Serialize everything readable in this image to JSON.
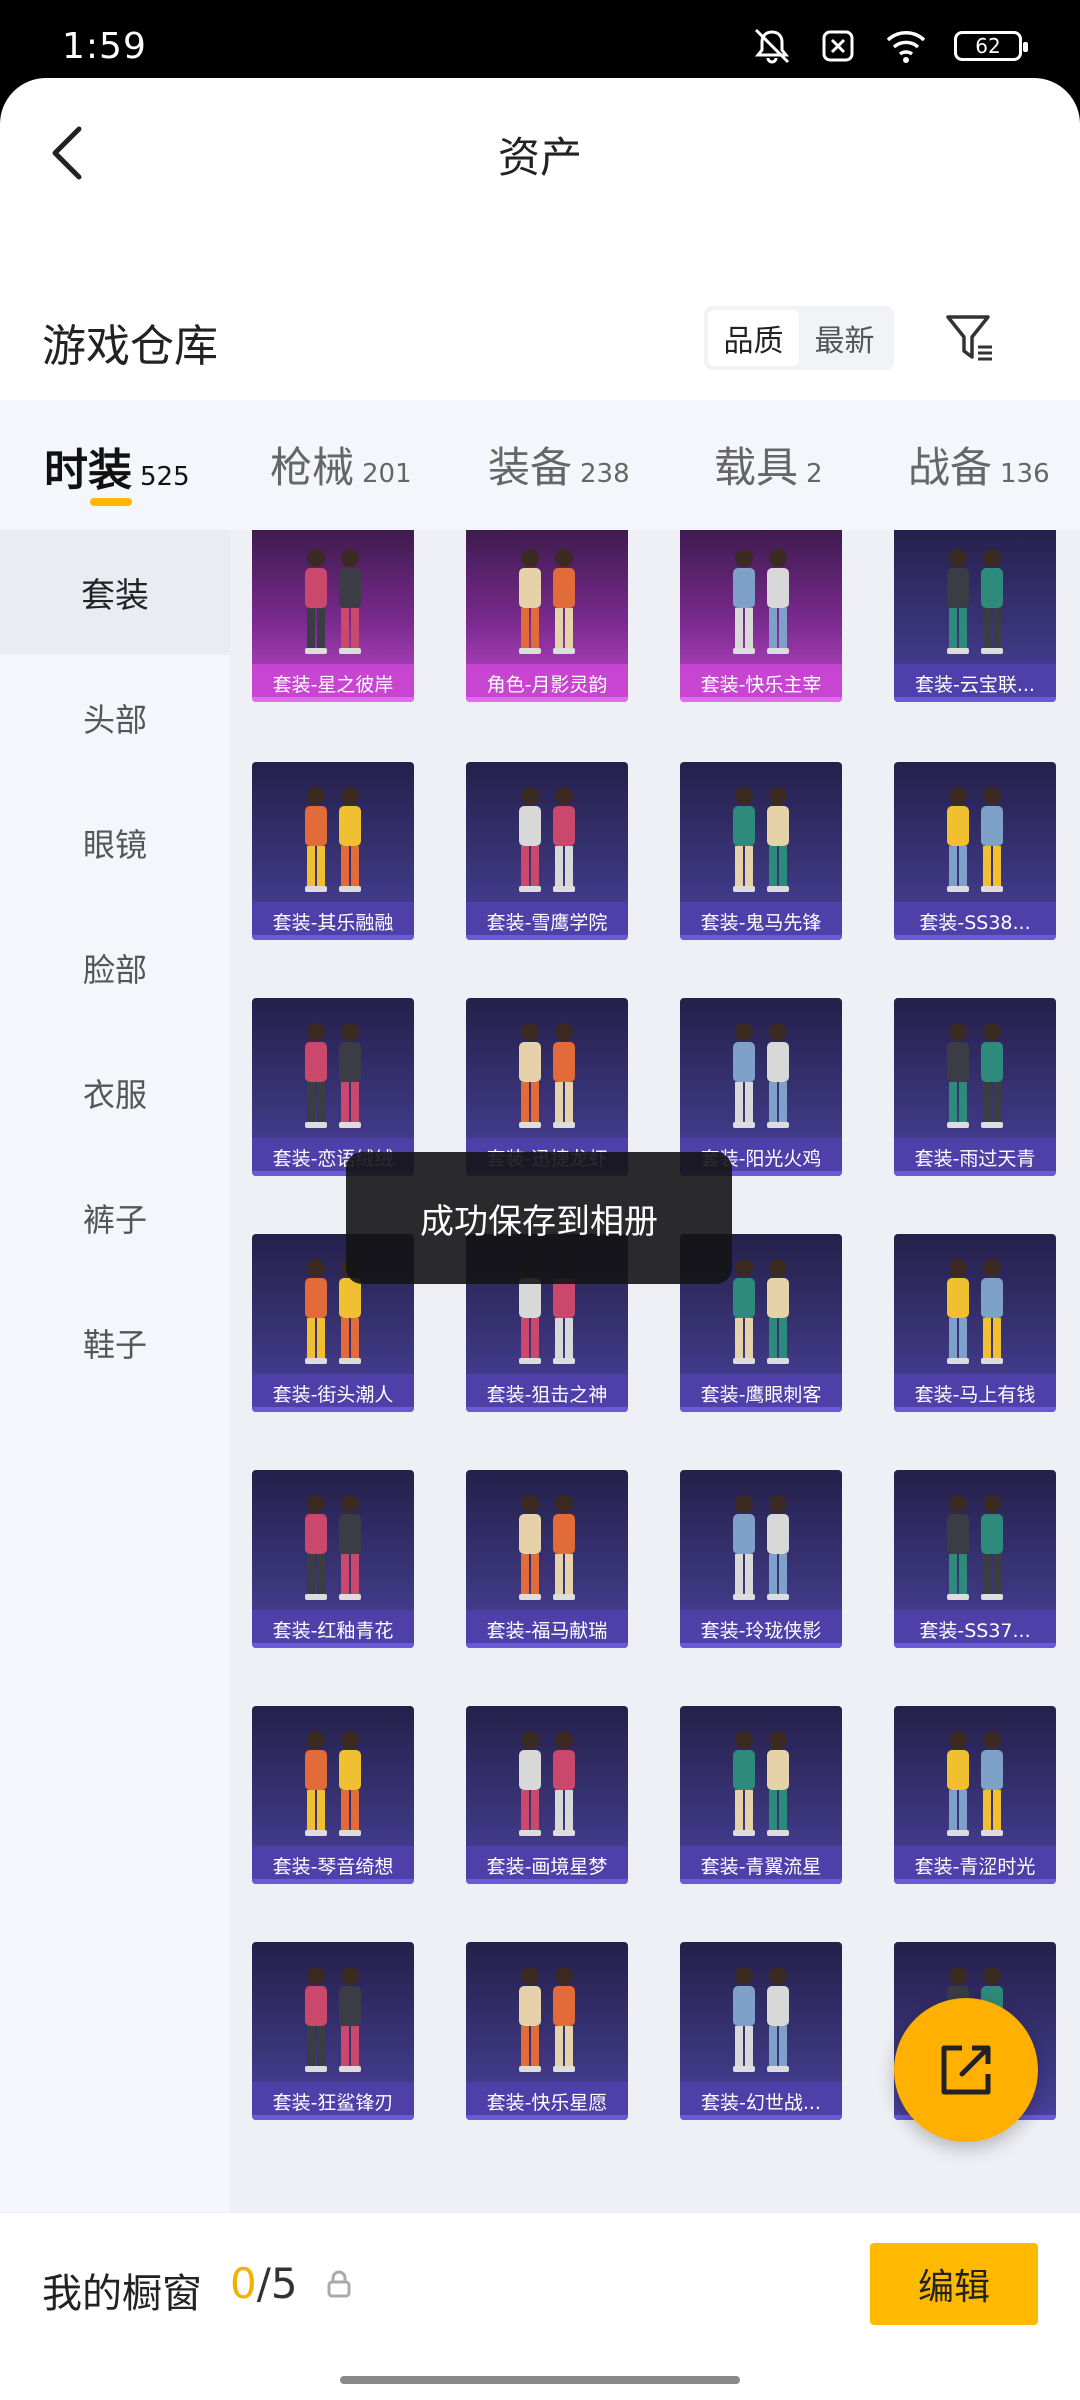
{
  "status_bar": {
    "time": "1:59",
    "battery": "62"
  },
  "header": {
    "title": "资产"
  },
  "section": {
    "title": "游戏仓库"
  },
  "sort": {
    "options": [
      "品质",
      "最新"
    ],
    "active": 0
  },
  "tabs": [
    {
      "label": "时装",
      "count": "525"
    },
    {
      "label": "枪械",
      "count": "201"
    },
    {
      "label": "装备",
      "count": "238"
    },
    {
      "label": "载具",
      "count": "2"
    },
    {
      "label": "战备",
      "count": "136"
    }
  ],
  "sidebar": {
    "items": [
      "套装",
      "头部",
      "眼镜",
      "脸部",
      "衣服",
      "裤子",
      "鞋子"
    ]
  },
  "grid": {
    "items": [
      "套装-星之彼岸",
      "角色-月影灵韵",
      "套装-快乐主宰",
      "套装-云宝联...",
      "套装-其乐融融",
      "套装-雪鹰学院",
      "套装-鬼马先锋",
      "套装-SS38...",
      "套装-恋语绒绒",
      "套装-迅捷龙虾",
      "套装-阳光火鸡",
      "套装-雨过天青",
      "套装-街头潮人",
      "套装-狙击之神",
      "套装-鹰眼刺客",
      "套装-马上有钱",
      "套装-红釉青花",
      "套装-福马献瑞",
      "套装-玲珑侠影",
      "套装-SS37...",
      "套装-琴音绮想",
      "套装-画境星梦",
      "套装-青翼流星",
      "套装-青涩时光",
      "套装-狂鲨锋刃",
      "套装-快乐星愿",
      "套装-幻世战...",
      ""
    ]
  },
  "toast": {
    "message": "成功保存到相册"
  },
  "showcase": {
    "label": "我的橱窗",
    "current": "0",
    "total": "/5",
    "edit_label": "编辑"
  },
  "colors": {
    "accent": "#ffb700",
    "card_purple": "#4b41a0",
    "card_pink": "#c04ad0"
  }
}
